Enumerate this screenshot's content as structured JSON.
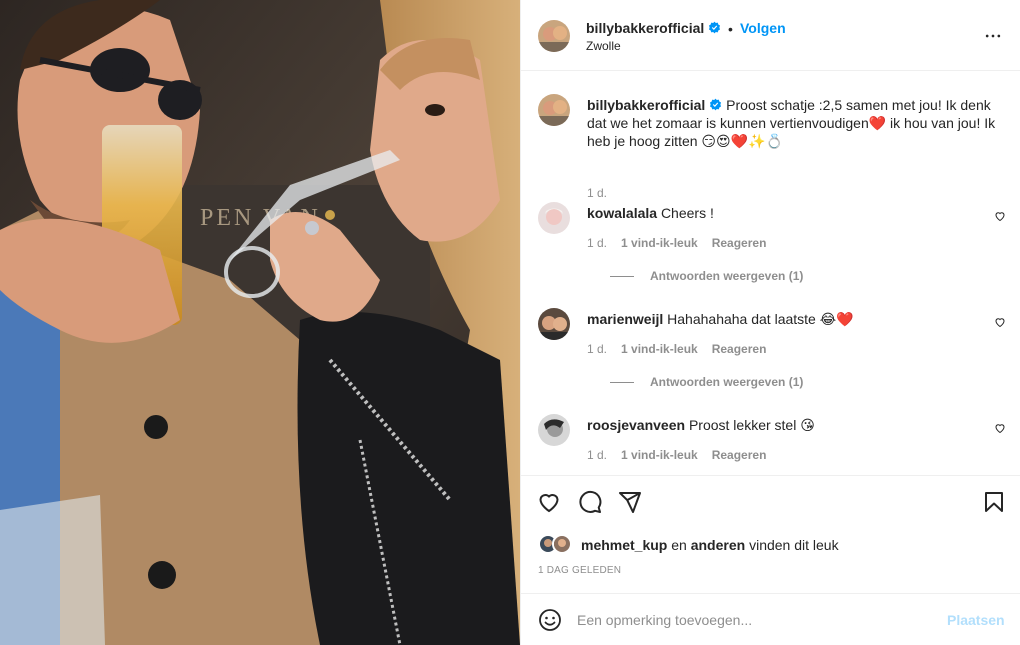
{
  "post": {
    "username": "billybakkerofficial",
    "separator": "•",
    "follow_label": "Volgen",
    "location": "Zwolle",
    "caption": {
      "username": "billybakkerofficial",
      "text": "Proost schatje :2,5 samen met jou! Ik denk dat we het zomaar is kunnen vertienvoudigen❤️ ik hou van jou! Ik heb je hoog zitten 😏😍❤️✨💍",
      "time": "1 d."
    },
    "comments": [
      {
        "username": "kowalalala",
        "text": "Cheers !",
        "time": "1 d.",
        "likes": "1 vind-ik-leuk",
        "reply": "Reageren",
        "replies": "Antwoorden weergeven (1)"
      },
      {
        "username": "marienweijl",
        "text": "Hahahahaha dat laatste 😂❤️",
        "time": "1 d.",
        "likes": "1 vind-ik-leuk",
        "reply": "Reageren",
        "replies": "Antwoorden weergeven (1)"
      },
      {
        "username": "roosjevanveen",
        "text": "Proost lekker stel 😘",
        "time": "1 d.",
        "likes": "1 vind-ik-leuk",
        "reply": "Reageren"
      }
    ],
    "likes": {
      "user": "mehmet_kup",
      "connector": "en",
      "others": "anderen",
      "suffix": "vinden dit leuk"
    },
    "date": "1 DAG GELEDEN",
    "add_comment": {
      "placeholder": "Een opmerking toevoegen...",
      "post_label": "Plaatsen"
    }
  },
  "colors": {
    "accent": "#0095f6",
    "text": "#262626",
    "muted": "#8e8e8e",
    "border": "#efefef",
    "heart": "#ed4956"
  },
  "icons": [
    "verified-badge-icon",
    "more-options-icon",
    "heart-icon",
    "comment-icon",
    "share-icon",
    "bookmark-icon",
    "emoji-icon"
  ]
}
